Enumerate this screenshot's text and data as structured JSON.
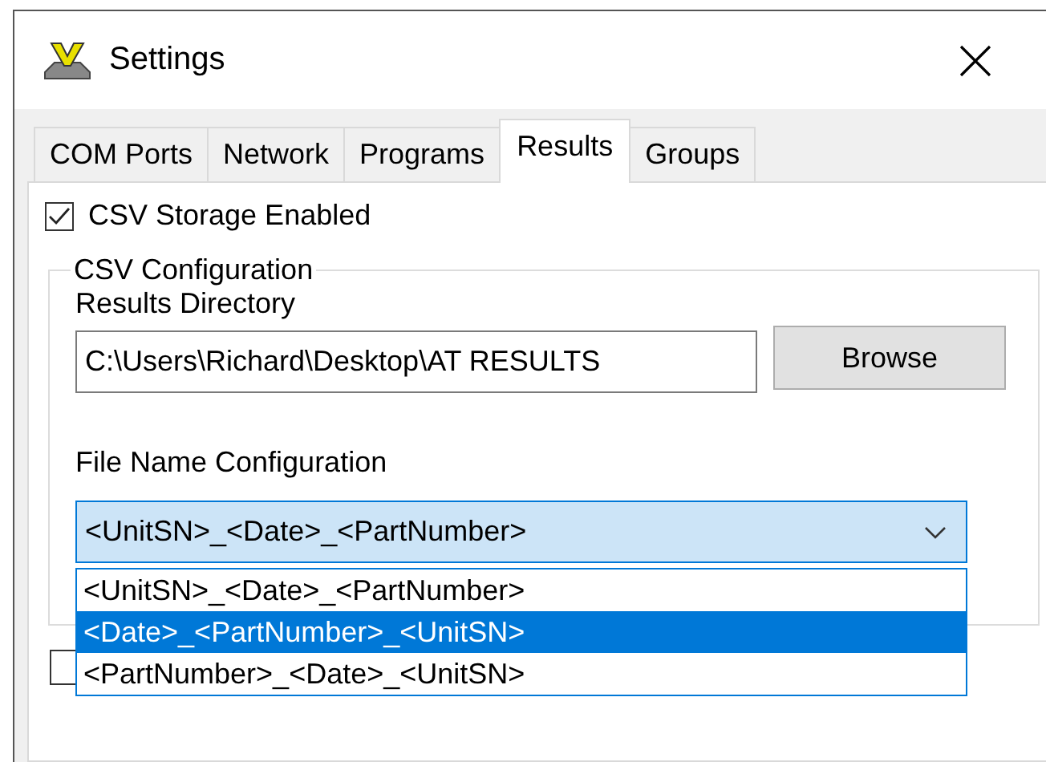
{
  "window": {
    "title": "Settings"
  },
  "tabs": [
    {
      "label": "COM Ports",
      "selected": false
    },
    {
      "label": "Network",
      "selected": false
    },
    {
      "label": "Programs",
      "selected": false
    },
    {
      "label": "Results",
      "selected": true
    },
    {
      "label": "Groups",
      "selected": false
    }
  ],
  "csv_storage": {
    "label": "CSV Storage Enabled",
    "checked": true
  },
  "csv_configuration": {
    "title": "CSV Configuration",
    "directory_label": "Results Directory",
    "directory_value": "C:\\Users\\Richard\\Desktop\\AT RESULTS",
    "browse_button": "Browse",
    "file_name_label": "File Name Configuration",
    "file_name_value": "<UnitSN>_<Date>_<PartNumber>",
    "options": [
      {
        "label": "<UnitSN>_<Date>_<PartNumber>",
        "selected": false
      },
      {
        "label": "<Date>_<PartNumber>_<UnitSN>",
        "selected": true
      },
      {
        "label": "<PartNumber>_<Date>_<UnitSN>",
        "selected": false
      }
    ]
  },
  "hidden_checkbox": {
    "checked": false
  }
}
